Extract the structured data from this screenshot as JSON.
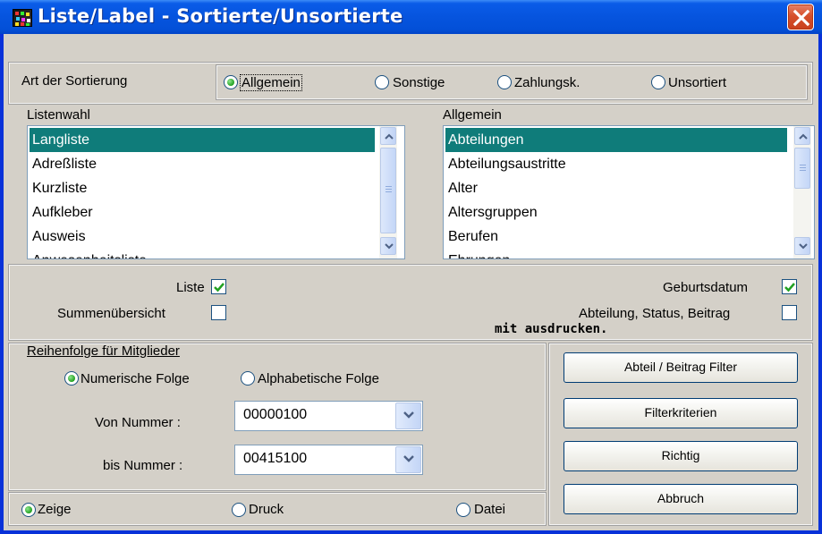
{
  "window": {
    "title": "Liste/Label - Sortierte/Unsortierte"
  },
  "sort": {
    "label": "Art der Sortierung",
    "options": [
      {
        "label": "Allgemein",
        "selected": true
      },
      {
        "label": "Sonstige",
        "selected": false
      },
      {
        "label": "Zahlungsk.",
        "selected": false
      },
      {
        "label": "Unsortiert",
        "selected": false
      }
    ]
  },
  "listenwahl": {
    "label": "Listenwahl",
    "items": [
      "Langliste",
      "Adreßliste",
      "Kurzliste",
      "Aufkleber",
      "Ausweis",
      "Anwesenheitsliste"
    ],
    "selected_index": 0
  },
  "allgemein": {
    "label": "Allgemein",
    "items": [
      "Abteilungen",
      "Abteilungsaustritte",
      "Alter",
      "Altersgruppen",
      "Berufen",
      "Ehrungen"
    ],
    "selected_index": 0
  },
  "checks": {
    "liste": {
      "label": "Liste",
      "checked": true
    },
    "summen": {
      "label": "Summenübersicht",
      "checked": false
    },
    "geburtsdatum": {
      "label": "Geburtsdatum",
      "checked": true
    },
    "abteilung": {
      "label": "Abteilung, Status, Beitrag",
      "checked": false
    },
    "note": "mit ausdrucken."
  },
  "reihenfolge": {
    "label": "Reihenfolge für Mitglieder",
    "numerisch": {
      "label": "Numerische Folge",
      "selected": true
    },
    "alpha": {
      "label": "Alphabetische Folge",
      "selected": false
    },
    "von_label": "Von Nummer :",
    "von_value": "00000100",
    "bis_label": "bis Nummer :",
    "bis_value": "00415100"
  },
  "output": {
    "zeige": {
      "label": "Zeige",
      "selected": true
    },
    "druck": {
      "label": "Druck",
      "selected": false
    },
    "datei": {
      "label": "Datei",
      "selected": false
    }
  },
  "buttons": {
    "filter": "Abteil / Beitrag Filter",
    "kriterien": "Filterkriterien",
    "richtig": "Richtig",
    "abbruch": "Abbruch"
  }
}
